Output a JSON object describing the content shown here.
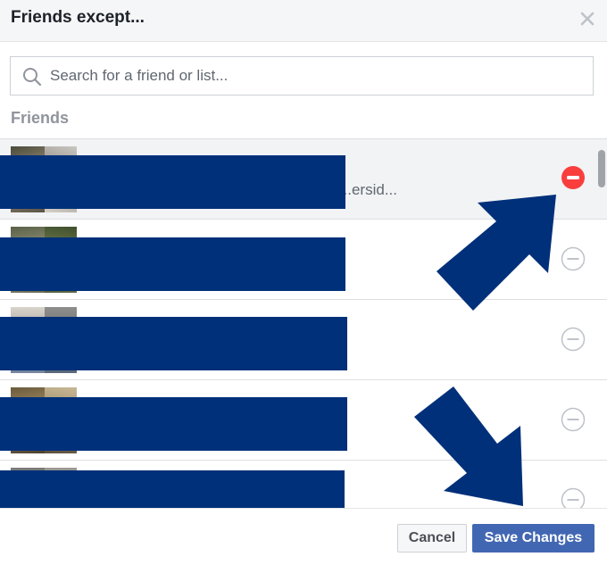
{
  "dialog": {
    "title": "Friends except...",
    "close_icon": "close-icon"
  },
  "search": {
    "placeholder": "Search for a friend or list...",
    "value": "",
    "icon": "search-icon"
  },
  "section": {
    "title": "Friends"
  },
  "friends": [
    {
      "name": "",
      "subtext": "...ersid...",
      "excluded": true
    },
    {
      "name": "",
      "subtext": "",
      "excluded": false
    },
    {
      "name": "",
      "subtext": "",
      "excluded": false
    },
    {
      "name": "",
      "subtext": "",
      "excluded": false
    },
    {
      "name": "",
      "subtext": "",
      "excluded": false
    }
  ],
  "footer": {
    "cancel_label": "Cancel",
    "save_label": "Save Changes"
  },
  "colors": {
    "primary": "#4267b2",
    "remove_active": "#fa3e3e",
    "redaction": "#00307a"
  }
}
